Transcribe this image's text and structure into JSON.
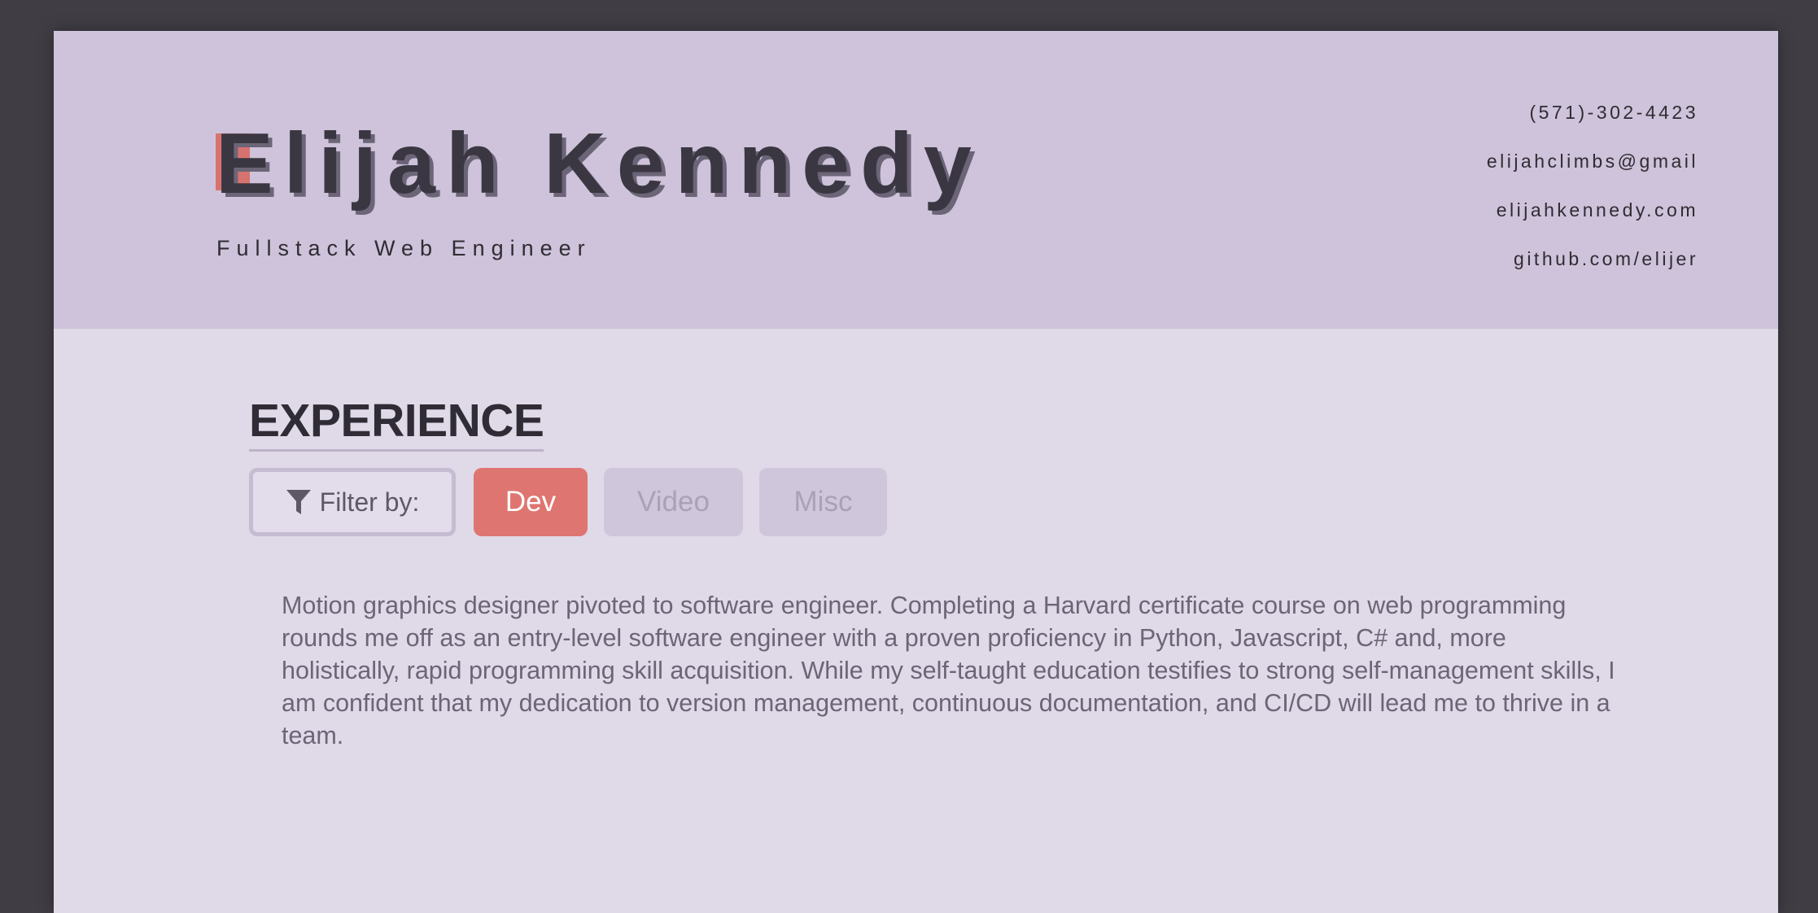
{
  "header": {
    "name": "Elijah Kennedy",
    "subtitle": "Fullstack Web Engineer",
    "contacts": {
      "phone": "(571)-302-4423",
      "email": "elijahclimbs@gmail",
      "website": "elijahkennedy.com",
      "github": "github.com/elijer"
    }
  },
  "experience": {
    "title": "EXPERIENCE",
    "filter": {
      "label": "Filter by:",
      "icon": "funnel-icon",
      "options": [
        {
          "label": "Dev",
          "active": true
        },
        {
          "label": "Video",
          "active": false
        },
        {
          "label": "Misc",
          "active": false
        }
      ]
    },
    "summary": "Motion graphics designer pivoted to software engineer. Completing a Harvard certificate course on web programming rounds me off as an entry-level software engineer with a proven proficiency in Python, Javascript, C# and, more holistically, rapid programming skill acquisition. While my self-taught education testifies to strong self-management skills, I am confident that my dedication to version management, continuous documentation, and CI/CD will lead me to thrive in a team."
  },
  "colors": {
    "background": "#403d45",
    "page": "#e0d9e8",
    "header": "#cec3da",
    "accent": "#df7570",
    "text_dark": "#2f2c33",
    "chip_inactive": "#cfc6db"
  }
}
